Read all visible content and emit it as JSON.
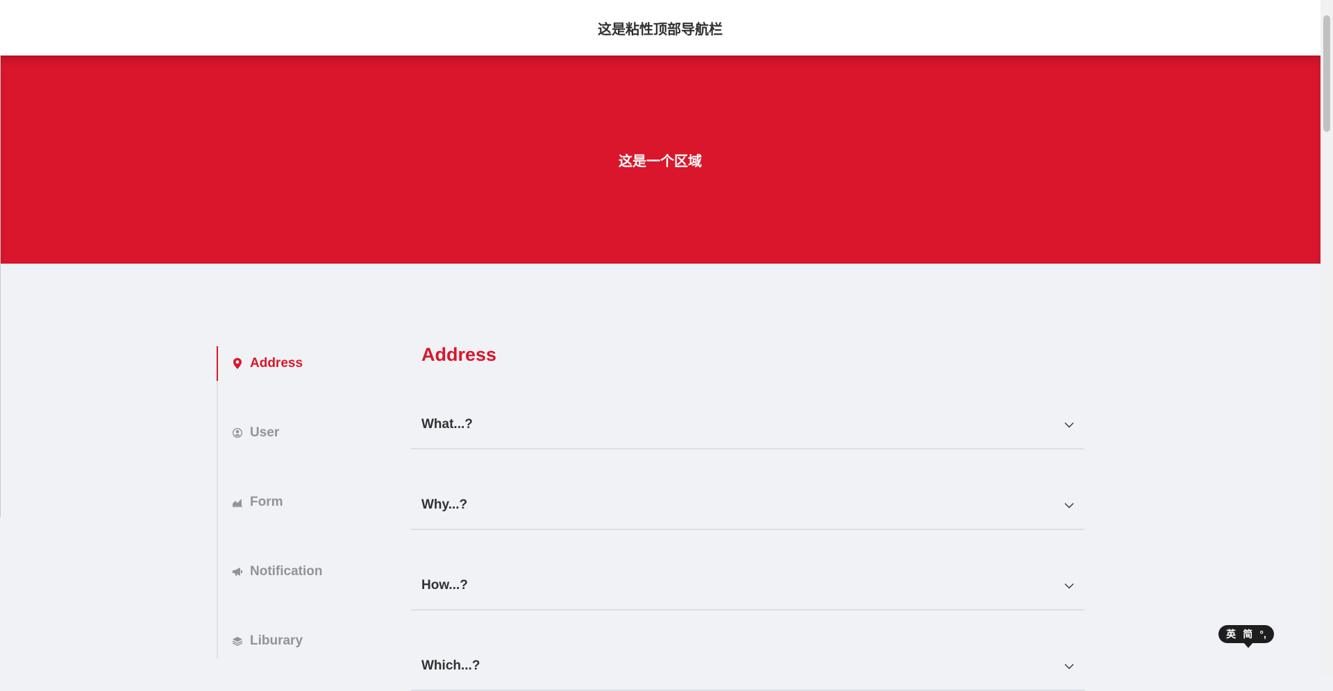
{
  "topnav": {
    "title": "这是粘性顶部导航栏"
  },
  "hero": {
    "text": "这是一个区域"
  },
  "sidebar": {
    "items": [
      {
        "label": "Address",
        "icon": "map-pin-icon",
        "active": true
      },
      {
        "label": "User",
        "icon": "user-icon",
        "active": false
      },
      {
        "label": "Form",
        "icon": "chart-icon",
        "active": false
      },
      {
        "label": "Notification",
        "icon": "megaphone-icon",
        "active": false
      },
      {
        "label": "Liburary",
        "icon": "layers-icon",
        "active": false
      }
    ]
  },
  "content": {
    "title": "Address",
    "questions": [
      "What...?",
      "Why...?",
      "How...?",
      "Which...?"
    ]
  },
  "ime": {
    "lang": "英",
    "mode": "简",
    "punct": "°,"
  },
  "colors": {
    "accent": "#d9162b",
    "background": "#f0f2f5",
    "muted": "#909399",
    "text": "#303133"
  }
}
